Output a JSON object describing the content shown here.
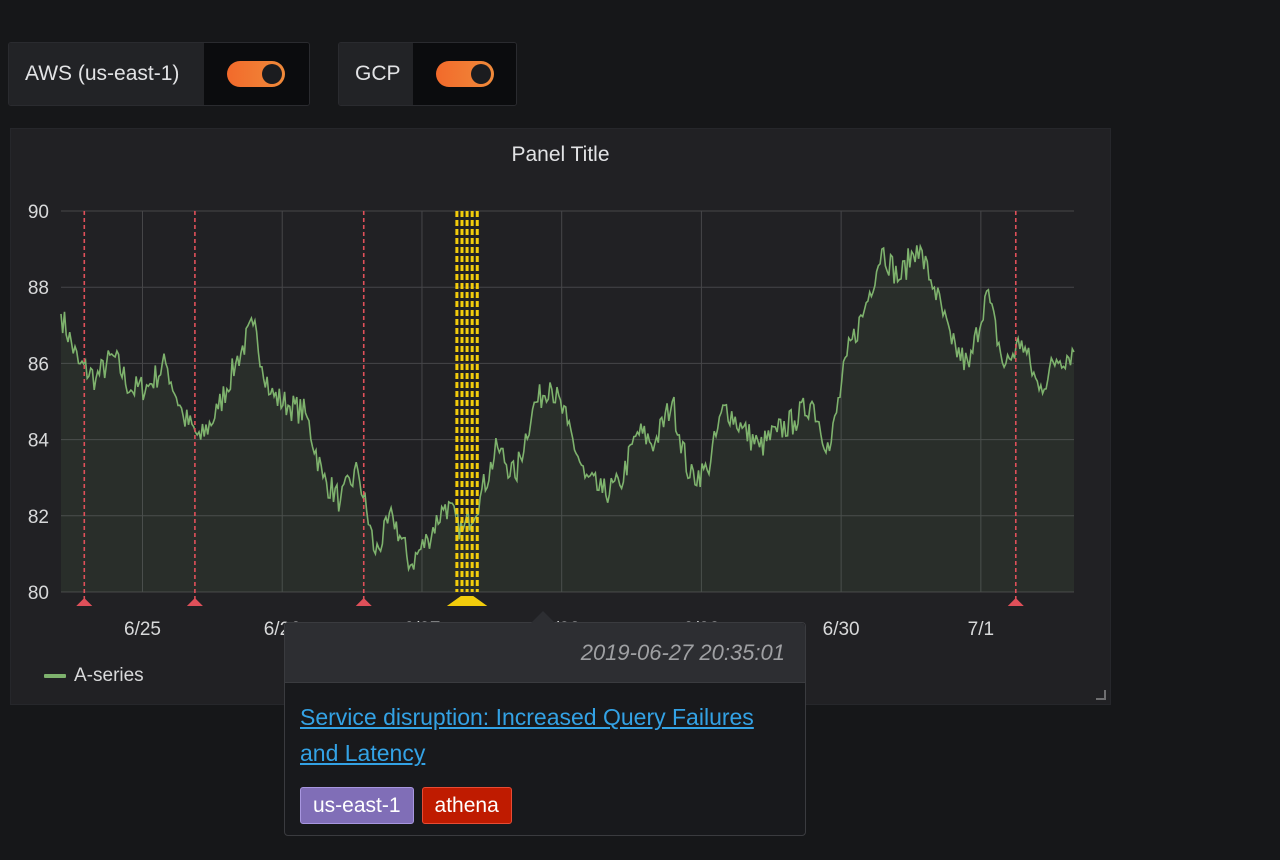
{
  "variables": [
    {
      "label": "AWS (us-east-1)",
      "enabled": true
    },
    {
      "label": "GCP",
      "enabled": true
    }
  ],
  "panel": {
    "title": "Panel Title",
    "legend": {
      "series_name": "A-series",
      "color": "#7eb26d"
    }
  },
  "chart_data": {
    "type": "area",
    "title": "Panel Title",
    "xlabel": "",
    "ylabel": "",
    "ylim": [
      80,
      90
    ],
    "yticks": [
      80,
      82,
      84,
      86,
      88,
      90
    ],
    "xlim": [
      "2019-06-24 10:00",
      "2019-07-01 16:00"
    ],
    "xticks": [
      "6/25",
      "6/26",
      "6/27",
      "6/28",
      "6/29",
      "6/30",
      "7/1"
    ],
    "grid": true,
    "legend_placement": "bottom-left",
    "series": [
      {
        "name": "A-series",
        "color": "#7eb26d",
        "x": [
          "2019-06-24 10:00",
          "2019-06-24 13:00",
          "2019-06-24 16:00",
          "2019-06-24 19:00",
          "2019-06-24 22:00",
          "2019-06-25 01:00",
          "2019-06-25 04:00",
          "2019-06-25 07:00",
          "2019-06-25 10:00",
          "2019-06-25 13:00",
          "2019-06-25 16:00",
          "2019-06-25 19:00",
          "2019-06-25 22:00",
          "2019-06-26 01:00",
          "2019-06-26 04:00",
          "2019-06-26 07:00",
          "2019-06-26 10:00",
          "2019-06-26 13:00",
          "2019-06-26 16:00",
          "2019-06-26 19:00",
          "2019-06-26 22:00",
          "2019-06-27 01:00",
          "2019-06-27 04:00",
          "2019-06-27 07:00",
          "2019-06-27 10:00",
          "2019-06-27 13:00",
          "2019-06-27 16:00",
          "2019-06-27 19:00",
          "2019-06-27 22:00",
          "2019-06-28 01:00",
          "2019-06-28 04:00",
          "2019-06-28 07:00",
          "2019-06-28 10:00",
          "2019-06-28 13:00",
          "2019-06-28 16:00",
          "2019-06-28 19:00",
          "2019-06-28 22:00",
          "2019-06-29 01:00",
          "2019-06-29 04:00",
          "2019-06-29 07:00",
          "2019-06-29 10:00",
          "2019-06-29 13:00",
          "2019-06-29 16:00",
          "2019-06-29 19:00",
          "2019-06-29 22:00",
          "2019-06-30 01:00",
          "2019-06-30 04:00",
          "2019-06-30 07:00",
          "2019-06-30 10:00",
          "2019-06-30 13:00",
          "2019-06-30 16:00",
          "2019-06-30 19:00",
          "2019-06-30 22:00",
          "2019-07-01 01:00",
          "2019-07-01 04:00",
          "2019-07-01 07:00",
          "2019-07-01 10:00",
          "2019-07-01 13:00",
          "2019-07-01 16:00"
        ],
        "values": [
          87.3,
          86.0,
          85.6,
          86.2,
          85.3,
          85.4,
          86.0,
          84.6,
          84.0,
          84.8,
          86.0,
          87.0,
          85.2,
          84.9,
          84.7,
          83.0,
          82.4,
          83.2,
          81.0,
          82.0,
          80.7,
          81.4,
          82.3,
          81.6,
          82.5,
          83.8,
          83.0,
          84.8,
          85.5,
          84.4,
          83.0,
          82.6,
          82.8,
          84.2,
          83.9,
          85.0,
          83.0,
          83.2,
          84.9,
          84.3,
          83.8,
          84.2,
          84.5,
          85.0,
          83.7,
          86.2,
          87.4,
          89.0,
          88.2,
          89.1,
          88.0,
          86.5,
          85.9,
          87.9,
          85.9,
          86.6,
          85.3,
          86.1,
          86.3
        ]
      }
    ],
    "annotations": [
      {
        "time": "2019-06-24 14:00"
      },
      {
        "time": "2019-06-25 09:00"
      },
      {
        "time": "2019-06-26 14:00"
      },
      {
        "time": "2019-06-27 06:00",
        "region_end": "2019-06-27 09:30"
      },
      {
        "time": "2019-07-01 06:00"
      }
    ]
  },
  "tooltip": {
    "time": "2019-06-27 20:35:01",
    "title": "Service disruption: Increased Query Failures and Latency",
    "tags": [
      "us-east-1",
      "athena"
    ]
  },
  "colors": {
    "background": "#161719",
    "panel": "#212124",
    "grid": "#464649",
    "series": "#7eb26d",
    "annotation_red": "#e0505a",
    "annotation_yellow": "#f2cc0c",
    "link": "#33a2e5",
    "tag_region": "#806eb7",
    "tag_service": "#bf1b00",
    "toggle_on": "#f26a2b"
  }
}
